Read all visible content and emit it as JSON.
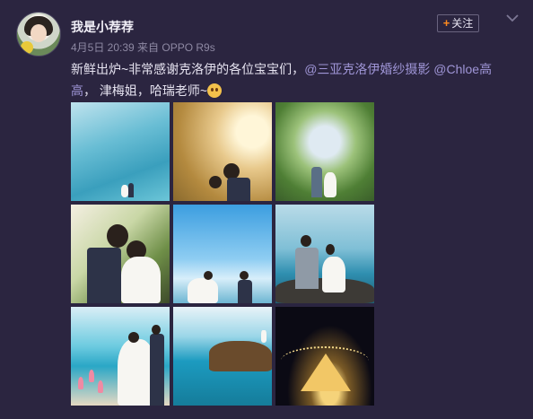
{
  "post": {
    "username": "我是小荐荐",
    "meta": "4月5日 20:39 来自 OPPO R9s",
    "follow_label": "关注",
    "text_part1": "新鲜出炉~非常感谢克洛伊的各位宝宝们，",
    "mention1": "@三亚克洛伊婚纱摄影",
    "text_space": " ",
    "mention2": "@Chloe高高",
    "text_part2": "， 津梅姐，哈瑞老师~"
  },
  "icons": {
    "follow": "plus-icon",
    "menu": "chevron-down-icon",
    "emoji": "emoji-icon"
  },
  "colors": {
    "background": "#2b2540",
    "mention": "#9f95d6",
    "follow_plus": "#ff8a1f"
  },
  "photos": [
    {
      "name": "photo-1"
    },
    {
      "name": "photo-2"
    },
    {
      "name": "photo-3"
    },
    {
      "name": "photo-4"
    },
    {
      "name": "photo-5"
    },
    {
      "name": "photo-6"
    },
    {
      "name": "photo-7"
    },
    {
      "name": "photo-8"
    },
    {
      "name": "photo-9"
    }
  ]
}
